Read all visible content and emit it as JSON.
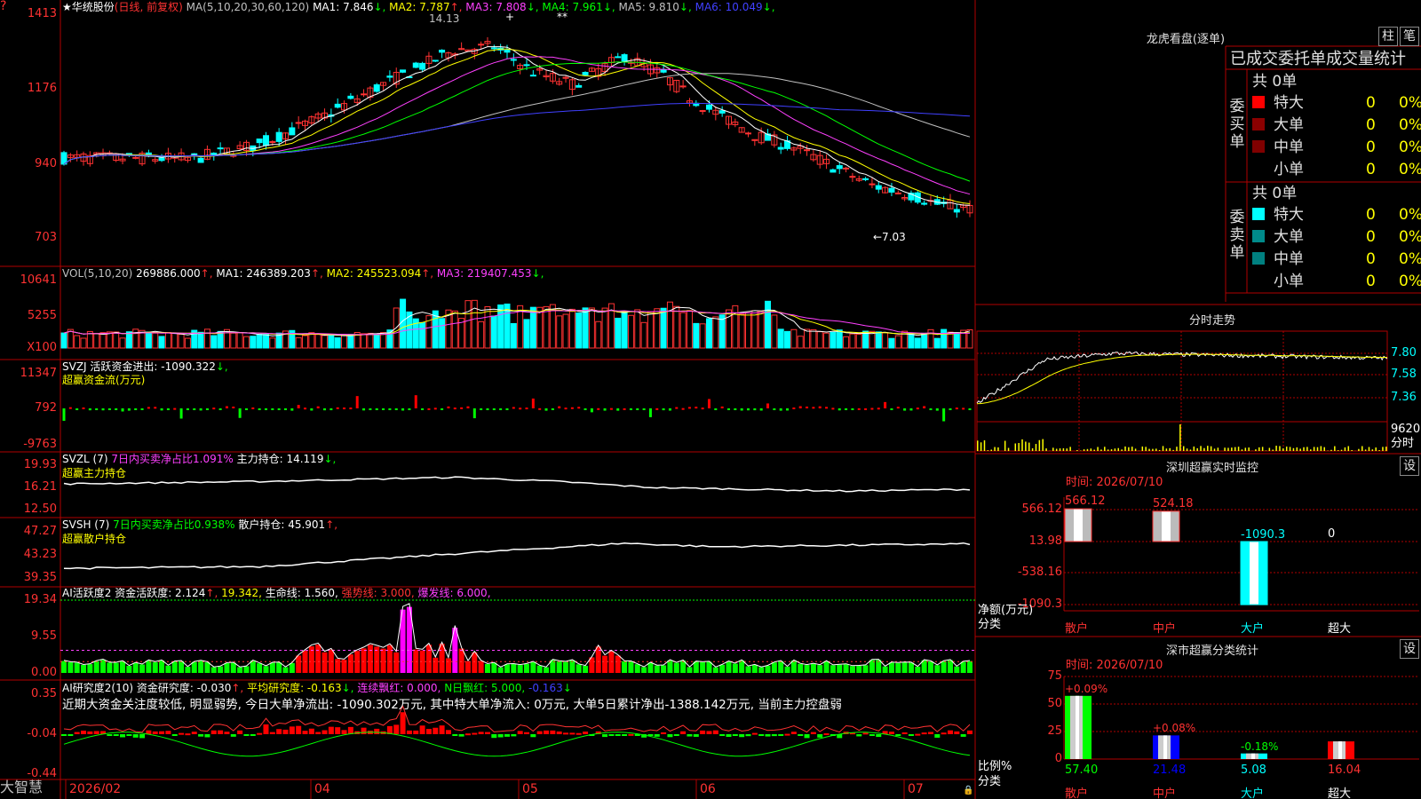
{
  "app": {
    "brand": "大智慧"
  },
  "stock": {
    "name": "华统股份",
    "period": "(日线, 前复权)"
  },
  "main": {
    "star_icon": "star-icon",
    "ma_def": "MA(5,10,20,30,60,120)",
    "ma": [
      {
        "label": "MA1:",
        "value": "7.846",
        "arrow": "↓",
        "color": "#ffffff"
      },
      {
        "label": "MA2:",
        "value": "7.787",
        "arrow": "↑",
        "color": "#ffff00"
      },
      {
        "label": "MA3:",
        "value": "7.808",
        "arrow": "↓",
        "color": "#ff40ff"
      },
      {
        "label": "MA4:",
        "value": "7.961",
        "arrow": "↓",
        "color": "#00ff00"
      },
      {
        "label": "MA5:",
        "value": "9.810",
        "arrow": "↓",
        "color": "#c0c0c0"
      },
      {
        "label": "MA6:",
        "value": "10.049",
        "arrow": "↓",
        "color": "#4040ff"
      }
    ],
    "axis": [
      "1413",
      "1176",
      "940",
      "703"
    ],
    "high_label": "14.13",
    "low_label": "←7.03",
    "markers": [
      "+",
      "**"
    ]
  },
  "vol": {
    "def": "VOL(5,10,20)",
    "value": "269886.000",
    "ma": [
      {
        "label": "MA1:",
        "value": "246389.203",
        "arrow": "↑",
        "color": "#ffffff"
      },
      {
        "label": "MA2:",
        "value": "245523.094",
        "arrow": "↑",
        "color": "#ffff00"
      },
      {
        "label": "MA3:",
        "value": "219407.453",
        "arrow": "↓",
        "color": "#ff40ff"
      }
    ],
    "axis": [
      "10641",
      "5255",
      "X100"
    ]
  },
  "svzj": {
    "line1": "SVZJ  活跃资金进出: -1090.322",
    "arrow": "↓,",
    "line2": "超赢资金流(万元)",
    "axis": [
      "11347",
      "792",
      "-9763"
    ]
  },
  "svzl": {
    "def": "SVZL (7)",
    "ratio": "7日内买卖净占比1.091%",
    "hold_label": "主力持仓: 14.119",
    "arrow": "↓,",
    "line2": "超赢主力持仓",
    "axis": [
      "19.93",
      "16.21",
      "12.50"
    ]
  },
  "svsh": {
    "def": "SVSH (7)",
    "ratio": "7日内买卖净占比0.938%",
    "hold_label": "散户持仓: 45.901",
    "arrow": "↑,",
    "line2": "超赢散户持仓",
    "axis": [
      "47.27",
      "43.23",
      "39.35"
    ]
  },
  "ai1": {
    "def": "AI活跃度2 资金活跃度: 2.124",
    "a1": "↑,",
    "v2": "19.342,",
    "v3": "生命线: 1.560,",
    "v4": "强势线: 3.000,",
    "v5": "爆发线: 6.000,",
    "axis": [
      "19.34",
      "9.55",
      "0.00"
    ]
  },
  "ai2": {
    "def": "AI研究度2(10) 资金研究度: -0.030",
    "a1": "↑,",
    "v2": "平均研究度: -0.163",
    "a2": "↓,",
    "v3": "连续飘红: 0.000,",
    "v4": "N日飘红: 5.000,",
    "v5": "-0.163",
    "a5": "↓",
    "comment": "近期大资金关注度较低, 明显弱势, 今日大单净流出: -1090.302万元, 其中特大单净流入: 0万元, 大单5日累计净出-1388.142万元, 当前主力控盘弱",
    "axis": [
      "0.35",
      "-0.04",
      "-0.44"
    ]
  },
  "dates": [
    "2026/02",
    "04",
    "05",
    "06",
    "07"
  ],
  "panel_lhb": {
    "title": "龙虎看盘(逐单)",
    "btn1": "柱",
    "btn2": "笔",
    "header": "已成交委托单成交量统计",
    "buy_label": "委买单",
    "sell_label": "委卖单",
    "buy_total": "共 0单",
    "sell_total": "共 0单",
    "buy_rows": [
      {
        "name": "特大",
        "count": "0",
        "pct": "0%",
        "color": "#ff0000"
      },
      {
        "name": "大单",
        "count": "0",
        "pct": "0%",
        "color": "#8b0000"
      },
      {
        "name": "中单",
        "count": "0",
        "pct": "0%",
        "color": "#800000"
      },
      {
        "name": "小单",
        "count": "0",
        "pct": "0%",
        "color": "#000000"
      }
    ],
    "sell_rows": [
      {
        "name": "特大",
        "count": "0",
        "pct": "0%",
        "color": "#00ffff"
      },
      {
        "name": "大单",
        "count": "0",
        "pct": "0%",
        "color": "#008b8b"
      },
      {
        "name": "中单",
        "count": "0",
        "pct": "0%",
        "color": "#008080"
      },
      {
        "name": "小单",
        "count": "0",
        "pct": "0%",
        "color": "#000000"
      }
    ]
  },
  "panel_fs": {
    "title": "分时走势",
    "axis": [
      "7.80",
      "7.58",
      "7.36"
    ],
    "vol_axis": [
      "9620",
      "分时"
    ]
  },
  "panel_mon": {
    "title": "深圳超赢实时监控",
    "btn": "设",
    "time": "时间: 2026/07/10",
    "axis": [
      "566.12",
      "13.98",
      "-538.16",
      "-1090.3"
    ],
    "ylabel": "净额(万元)",
    "xlabel": "分类",
    "cats": [
      "散户",
      "中户",
      "大户",
      "超大"
    ],
    "values": [
      566.12,
      524.18,
      -1090.3,
      0
    ],
    "labels": [
      "566.12",
      "524.18",
      "-1090.3",
      "0"
    ]
  },
  "panel_cls": {
    "title": "深市超赢分类统计",
    "btn": "设",
    "time": "时间: 2026/07/10",
    "axis": [
      "75",
      "50",
      "25",
      "0"
    ],
    "ylabel": "比例%",
    "xlabel": "分类",
    "cats": [
      "散户",
      "中户",
      "大户",
      "超大"
    ],
    "values": [
      57.4,
      21.48,
      5.08,
      16.04
    ],
    "val_labels": [
      "57.40",
      "21.48",
      "5.08",
      "16.04"
    ],
    "changes": [
      "+0.09%",
      "+0.08%",
      "-0.18%",
      ""
    ]
  },
  "colors": {
    "up": "#ff3232",
    "down": "#00ffff",
    "grid": "#b00000",
    "green": "#00ff00",
    "magenta": "#ff00ff"
  }
}
